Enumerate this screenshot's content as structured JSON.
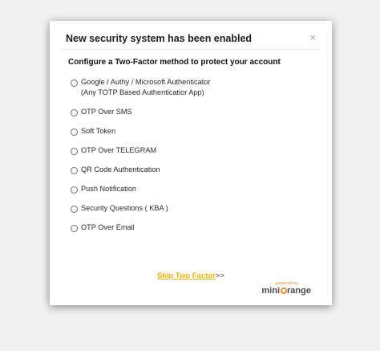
{
  "modal": {
    "title": "New security system has been enabled",
    "close_glyph": "×",
    "subtitle": "Configure a Two-Factor method to protect your account"
  },
  "options": [
    {
      "label": "Google / Authy / Microsoft Authenticator",
      "sublabel": "(Any TOTP Based Authenticatior App)"
    },
    {
      "label": "OTP Over SMS"
    },
    {
      "label": "Soft Token"
    },
    {
      "label": "OTP Over TELEGRAM"
    },
    {
      "label": "QR Code Authentication"
    },
    {
      "label": "Push Notification"
    },
    {
      "label": "Security Questions ( KBA )"
    },
    {
      "label": "OTP Over Email"
    }
  ],
  "footer": {
    "skip_label": "Skip Two Factor",
    "skip_suffix": ">>",
    "powered_by": "powered by",
    "brand_prefix": "mini",
    "brand_suffix": "range"
  },
  "colors": {
    "link": "#f4b400",
    "brand_accent": "#f08a24"
  }
}
